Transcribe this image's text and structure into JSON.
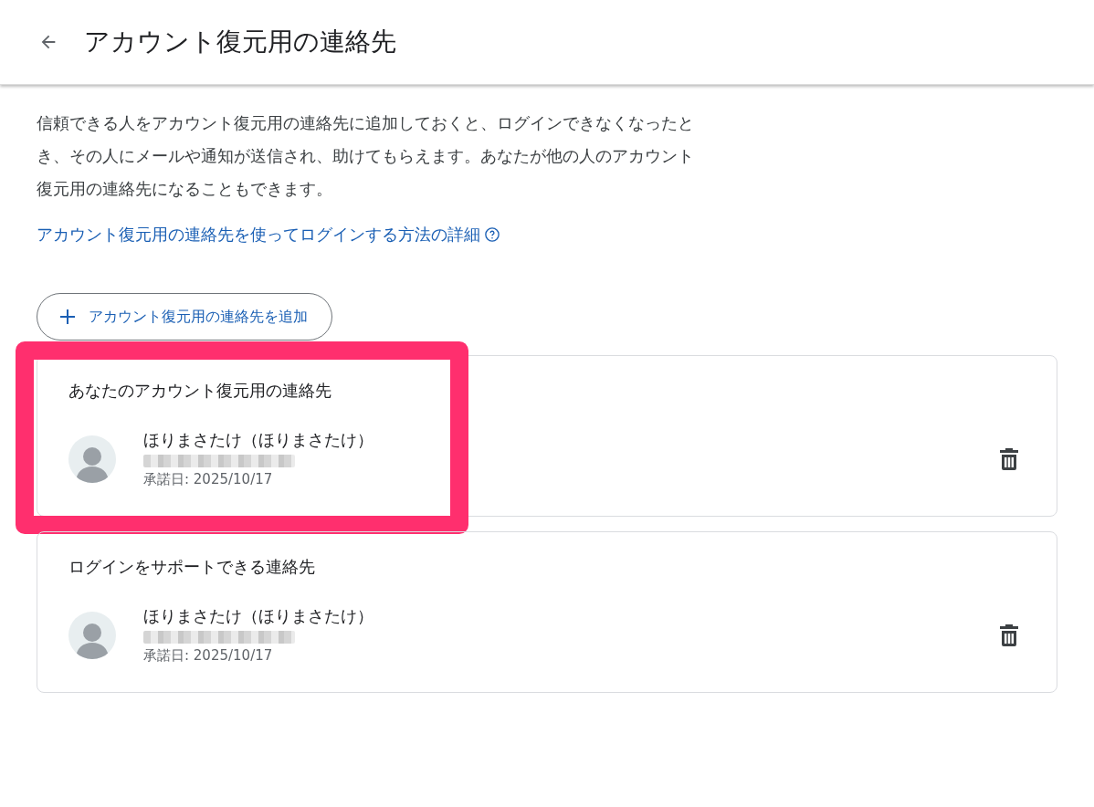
{
  "header": {
    "title": "アカウント復元用の連絡先"
  },
  "description": "信頼できる人をアカウント復元用の連絡先に追加しておくと、ログインできなくなったとき、その人にメールや通知が送信され、助けてもらえます。あなたが他の人のアカウント復元用の連絡先になることもできます。",
  "learn_more_link": "アカウント復元用の連絡先を使ってログインする方法の詳細",
  "add_button": "アカウント復元用の連絡先を追加",
  "sections": [
    {
      "title": "あなたのアカウント復元用の連絡先",
      "highlighted": true,
      "contact": {
        "name": "ほりまさたけ（ほりまさたけ）",
        "accepted": "承諾日: 2025/10/17"
      }
    },
    {
      "title": "ログインをサポートできる連絡先",
      "highlighted": false,
      "contact": {
        "name": "ほりまさたけ（ほりまさたけ）",
        "accepted": "承諾日: 2025/10/17"
      }
    }
  ]
}
